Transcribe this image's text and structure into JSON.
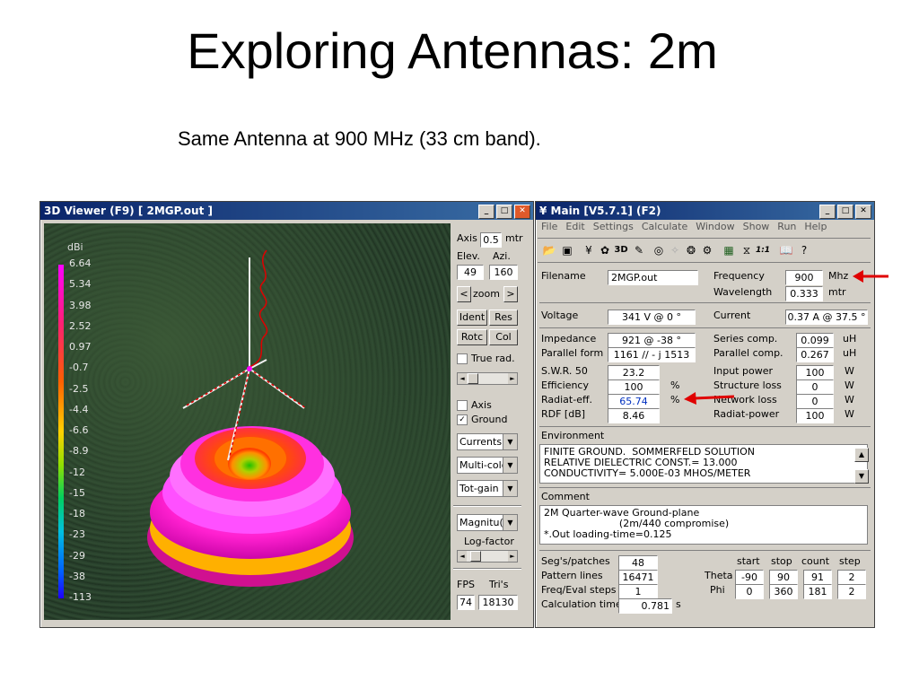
{
  "slide": {
    "title": "Exploring Antennas: 2m",
    "subtitle": "Same Antenna at 900 MHz (33 cm band)."
  },
  "viewer": {
    "title": "3D Viewer (F9)    [  2MGP.out ]",
    "legend_unit": "dBi",
    "legend_values": [
      "6.64",
      "5.34",
      "3.98",
      "2.52",
      "0.97",
      "-0.7",
      "-2.5",
      "-4.4",
      "-6.6",
      "-8.9",
      "-12",
      "-15",
      "-18",
      "-23",
      "-29",
      "-38",
      "-113"
    ],
    "axis_label": "Axis",
    "axis_value": "0.5",
    "axis_unit": "mtr",
    "elev_label": "Elev.",
    "azi_label": "Azi.",
    "elev_value": "49",
    "azi_value": "160",
    "zoom_label": "zoom",
    "zoom_prev": "<",
    "zoom_next": ">",
    "ident_label": "Ident",
    "res_label": "Res",
    "rotc_label": "Rotc",
    "col_label": "Col",
    "true_rad_label": "True rad.",
    "axis_check_label": "Axis",
    "ground_check_label": "Ground",
    "currents_select": "Currents",
    "multicolor_select": "Multi-colo",
    "totgain_select": "Tot-gain",
    "magnitude_select": "Magnitu(",
    "logfactor_label": "Log-factor",
    "fps_label": "FPS",
    "tris_label": "Tri's",
    "fps_value": "74",
    "tris_value": "18130"
  },
  "main": {
    "title": "Main [V5.7.1]  (F2)",
    "menu": [
      "File",
      "Edit",
      "Settings",
      "Calculate",
      "Window",
      "Show",
      "Run",
      "Help"
    ],
    "filename_label": "Filename",
    "filename_value": "2MGP.out",
    "frequency_label": "Frequency",
    "frequency_value": "900",
    "frequency_unit": "Mhz",
    "wavelength_label": "Wavelength",
    "wavelength_value": "0.333",
    "wavelength_unit": "mtr",
    "voltage_label": "Voltage",
    "voltage_value": "341 V @ 0 °",
    "current_label": "Current",
    "current_value": "0.37 A @ 37.5 °",
    "impedance_label": "Impedance",
    "impedance_value": "921 @ -38 °",
    "parallel_form_label": "Parallel form",
    "parallel_form_value": "1161 // - j 1513",
    "series_comp_label": "Series comp.",
    "series_comp_value": "0.099",
    "series_comp_unit": "uH",
    "parallel_comp_label": "Parallel comp.",
    "parallel_comp_value": "0.267",
    "parallel_comp_unit": "uH",
    "swr_label": "S.W.R. 50",
    "swr_value": "23.2",
    "efficiency_label": "Efficiency",
    "efficiency_value": "100",
    "efficiency_unit": "%",
    "radiat_eff_label": "Radiat-eff.",
    "radiat_eff_value": "65.74",
    "radiat_eff_unit": "%",
    "rdf_label": "RDF [dB]",
    "rdf_value": "8.46",
    "input_power_label": "Input power",
    "input_power_value": "100",
    "input_power_unit": "W",
    "structure_loss_label": "Structure loss",
    "structure_loss_value": "0",
    "structure_loss_unit": "W",
    "network_loss_label": "Network loss",
    "network_loss_value": "0",
    "network_loss_unit": "W",
    "radiat_power_label": "Radiat-power",
    "radiat_power_value": "100",
    "radiat_power_unit": "W",
    "environment_label": "Environment",
    "environment_text": "FINITE GROUND.  SOMMERFELD SOLUTION\nRELATIVE DIELECTRIC CONST.= 13.000\nCONDUCTIVITY= 5.000E-03 MHOS/METER",
    "comment_label": "Comment",
    "comment_text": "2M Quarter-wave Ground-plane\n                        (2m/440 compromise)\n*.Out loading-time=0.125",
    "segs_label": "Seg's/patches",
    "segs_value": "48",
    "pattern_lines_label": "Pattern lines",
    "pattern_lines_value": "16471",
    "freq_eval_label": "Freq/Eval steps",
    "freq_eval_value": "1",
    "calc_time_label": "Calculation time",
    "calc_time_value": "0.781",
    "calc_time_unit": "s",
    "col_start": "start",
    "col_stop": "stop",
    "col_count": "count",
    "col_step": "step",
    "theta_label": "Theta",
    "theta_values": [
      "-90",
      "90",
      "91",
      "2"
    ],
    "phi_label": "Phi",
    "phi_values": [
      "0",
      "360",
      "181",
      "2"
    ]
  },
  "colors": {
    "arrow": "#e00000",
    "titlebar": "#0a246a",
    "win_face": "#d4d0c8"
  }
}
